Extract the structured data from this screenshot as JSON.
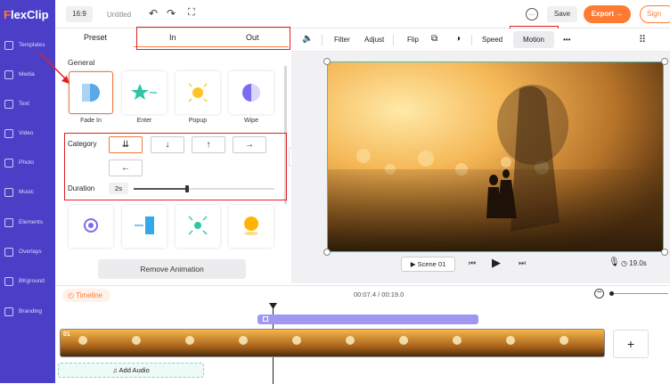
{
  "app": {
    "logo_f": "F",
    "logo_rest": "lexClip"
  },
  "sidebar": {
    "items": [
      {
        "label": "Templates",
        "icon": "templates-icon"
      },
      {
        "label": "Media",
        "icon": "media-icon"
      },
      {
        "label": "Text",
        "icon": "text-icon"
      },
      {
        "label": "Video",
        "icon": "video-icon"
      },
      {
        "label": "Photo",
        "icon": "photo-icon"
      },
      {
        "label": "Music",
        "icon": "music-icon"
      },
      {
        "label": "Elements",
        "icon": "elements-icon"
      },
      {
        "label": "Overlays",
        "icon": "overlays-icon"
      },
      {
        "label": "BKground",
        "icon": "background-icon"
      },
      {
        "label": "Branding",
        "icon": "branding-icon"
      }
    ]
  },
  "topbar": {
    "ratio": "16:9",
    "title": "Untitled",
    "save": "Save",
    "export": "Export →",
    "sign": "Sign"
  },
  "anim_panel": {
    "tabs": {
      "preset": "Preset",
      "in": "In",
      "out": "Out"
    },
    "section": "General",
    "effects": [
      "Fade In",
      "Enter",
      "Popup",
      "Wipe"
    ],
    "category_label": "Category",
    "directions": [
      "⇊",
      "↓",
      "↑",
      "→",
      "←"
    ],
    "duration_label": "Duration",
    "duration_value": "2s",
    "duration_fraction": 0.38,
    "remove_btn": "Remove Animation"
  },
  "toolbar": {
    "filter": "Filter",
    "adjust": "Adjust",
    "flip": "Flip",
    "speed": "Speed",
    "motion": "Motion",
    "more": "•••"
  },
  "player": {
    "scene": "▶ Scene 01",
    "duration": "19.0s"
  },
  "timeline": {
    "label": "Timeline",
    "time": "00:07.4 / 00:19.0",
    "clip_num": "01",
    "add_audio": "Add Audio",
    "add_clip": "+"
  },
  "colors": {
    "sidebar": "#4b3fc7",
    "accent": "#ff7a33",
    "highlight": "#e02020",
    "selection": "#35c4c4"
  }
}
